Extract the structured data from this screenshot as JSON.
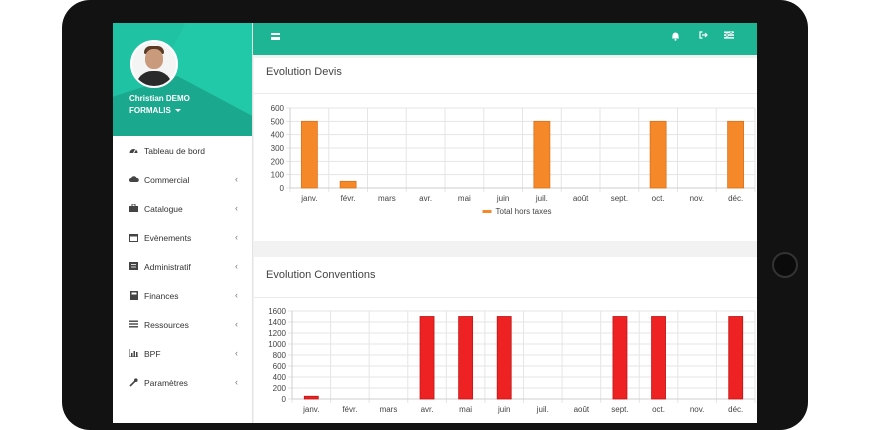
{
  "user": {
    "name": "Christian DEMO",
    "org": "FORMALIS"
  },
  "sidebar": {
    "items": [
      {
        "label": "Tableau de bord",
        "icon": "dashboard-icon",
        "has_children": false
      },
      {
        "label": "Commercial",
        "icon": "cloud-icon",
        "has_children": true
      },
      {
        "label": "Catalogue",
        "icon": "briefcase-icon",
        "has_children": true
      },
      {
        "label": "Evènements",
        "icon": "calendar-icon",
        "has_children": true
      },
      {
        "label": "Administratif",
        "icon": "list-icon",
        "has_children": true
      },
      {
        "label": "Finances",
        "icon": "calculator-icon",
        "has_children": true
      },
      {
        "label": "Ressources",
        "icon": "bars-icon",
        "has_children": true
      },
      {
        "label": "BPF",
        "icon": "bar-chart-icon",
        "has_children": true
      },
      {
        "label": "Paramètres",
        "icon": "wrench-icon",
        "has_children": true
      }
    ]
  },
  "topbar": {
    "icons": [
      "menu-icon",
      "bell-icon",
      "logout-icon",
      "settings-icon"
    ]
  },
  "panels": {
    "devis": {
      "title": "Evolution Devis"
    },
    "conventions": {
      "title": "Evolution Conventions"
    }
  },
  "chart_data": [
    {
      "type": "bar",
      "title": "Evolution Devis",
      "categories": [
        "janv.",
        "févr.",
        "mars",
        "avr.",
        "mai",
        "juin",
        "juil.",
        "août",
        "sept.",
        "oct.",
        "nov.",
        "déc."
      ],
      "series": [
        {
          "name": "Total hors taxes",
          "values": [
            500,
            50,
            0,
            0,
            0,
            0,
            500,
            0,
            0,
            500,
            0,
            500
          ],
          "color": "#f5892a"
        }
      ],
      "ylim": [
        0,
        600
      ],
      "yticks": [
        0,
        100,
        200,
        300,
        400,
        500,
        600
      ],
      "legend": "bottom",
      "grid": true
    },
    {
      "type": "bar",
      "title": "Evolution Conventions",
      "categories": [
        "janv.",
        "févr.",
        "mars",
        "avr.",
        "mai",
        "juin",
        "juil.",
        "août",
        "sept.",
        "oct.",
        "nov.",
        "déc."
      ],
      "series": [
        {
          "values": [
            50,
            0,
            0,
            1500,
            1500,
            1500,
            0,
            0,
            1500,
            1500,
            0,
            1500
          ],
          "color": "#ee2222"
        }
      ],
      "ylim": [
        0,
        1600
      ],
      "yticks": [
        0,
        200,
        400,
        600,
        800,
        1000,
        1200,
        1400,
        1600
      ],
      "grid": true
    }
  ]
}
